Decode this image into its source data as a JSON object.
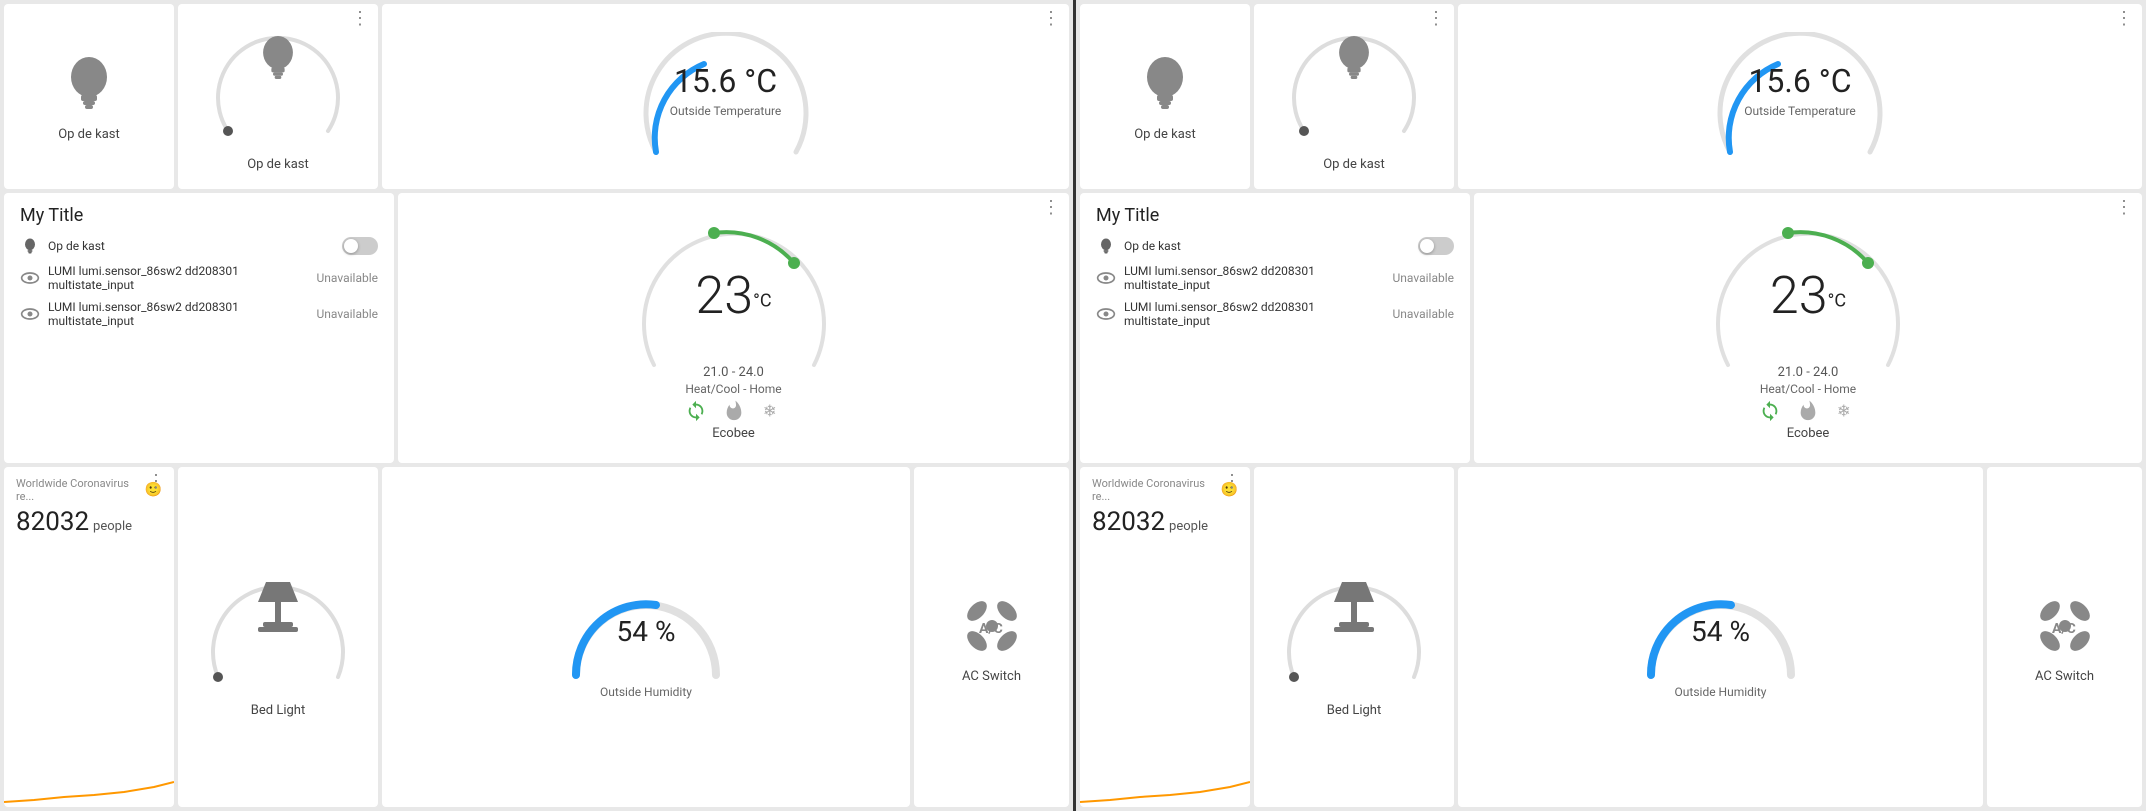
{
  "panels": [
    {
      "id": "left",
      "top_row": {
        "cards": [
          {
            "type": "bulb-simple",
            "label": "Op de kast",
            "show_dots": false
          },
          {
            "type": "bulb-dial",
            "label": "Op de kast",
            "show_dots": true,
            "dial_color": "#ccc"
          },
          {
            "type": "temperature",
            "value": "15.6 °C",
            "label": "Outside Temperature",
            "show_dots": true
          }
        ]
      },
      "middle_row": {
        "cards": [
          {
            "type": "my-title",
            "heading": "My Title",
            "sensors": [
              {
                "icon": "bulb",
                "name": "Op de kast",
                "status": "",
                "has_toggle": true
              },
              {
                "icon": "eye",
                "name": "LUMI lumi.sensor_86sw2 dd208301 multistate_input",
                "status": "Unavailable",
                "has_toggle": false
              },
              {
                "icon": "eye",
                "name": "LUMI lumi.sensor_86sw2 dd208301 multistate_input",
                "status": "Unavailable",
                "has_toggle": false
              }
            ]
          },
          {
            "type": "ecobee",
            "temp": "23",
            "unit": "°C",
            "range": "21.0 - 24.0",
            "mode": "Heat/Cool - Home",
            "label": "Ecobee",
            "show_dots": true
          }
        ]
      },
      "bottom_row": {
        "cards": [
          {
            "type": "corona",
            "title": "Worldwide Coronavirus re...",
            "count": "82032",
            "unit": "people",
            "show_dots": true
          },
          {
            "type": "bed-light",
            "label": "Bed Light",
            "show_dots": false
          },
          {
            "type": "humidity",
            "value": "54 %",
            "label": "Outside Humidity",
            "show_dots": false
          },
          {
            "type": "ac",
            "label": "AC Switch",
            "show_dots": false
          }
        ]
      }
    },
    {
      "id": "right",
      "top_row": {
        "cards": [
          {
            "type": "bulb-simple",
            "label": "Op de kast",
            "show_dots": false
          },
          {
            "type": "bulb-dial",
            "label": "Op de kast",
            "show_dots": true,
            "dial_color": "#ccc"
          },
          {
            "type": "temperature",
            "value": "15.6 °C",
            "label": "Outside Temperature",
            "show_dots": true
          }
        ]
      },
      "middle_row": {
        "cards": [
          {
            "type": "my-title",
            "heading": "My Title",
            "sensors": [
              {
                "icon": "bulb",
                "name": "Op de kast",
                "status": "",
                "has_toggle": true
              },
              {
                "icon": "eye",
                "name": "LUMI lumi.sensor_86sw2 dd208301 multistate_input",
                "status": "Unavailable",
                "has_toggle": false
              },
              {
                "icon": "eye",
                "name": "LUMI lumi.sensor_86sw2 dd208301 multistate_input",
                "status": "Unavailable",
                "has_toggle": false
              }
            ]
          },
          {
            "type": "ecobee",
            "temp": "23",
            "unit": "°C",
            "range": "21.0 - 24.0",
            "mode": "Heat/Cool - Home",
            "label": "Ecobee",
            "show_dots": true
          }
        ]
      },
      "bottom_row": {
        "cards": [
          {
            "type": "corona",
            "title": "Worldwide Coronavirus re...",
            "count": "82032",
            "unit": "people",
            "show_dots": true
          },
          {
            "type": "bed-light",
            "label": "Bed Light",
            "show_dots": false
          },
          {
            "type": "humidity",
            "value": "54 %",
            "label": "Outside Humidity",
            "show_dots": false
          },
          {
            "type": "ac",
            "label": "AC Switch",
            "show_dots": false
          }
        ]
      }
    }
  ],
  "icons": {
    "three_dots": "⋮",
    "bulb_unicode": "💡",
    "eye_unicode": "👁",
    "smile_unicode": "😊"
  }
}
